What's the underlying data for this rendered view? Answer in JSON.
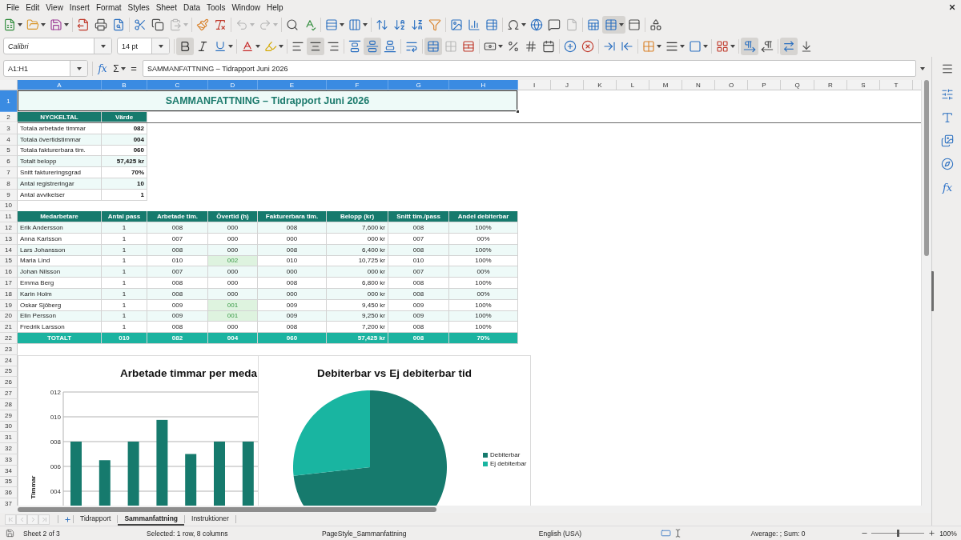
{
  "menu_bar": {
    "items": [
      "File",
      "Edit",
      "View",
      "Insert",
      "Format",
      "Styles",
      "Sheet",
      "Data",
      "Tools",
      "Window",
      "Help"
    ]
  },
  "standard_toolbar": {
    "groups": [
      [
        {
          "kind": "new",
          "on": false,
          "disabled": false
        },
        {
          "kind": "open",
          "on": false,
          "disabled": false
        },
        {
          "kind": "save",
          "on": false,
          "disabled": false
        }
      ],
      [
        {
          "kind": "export_pdf",
          "on": false,
          "disabled": false
        },
        {
          "kind": "print",
          "on": false,
          "disabled": false
        },
        {
          "kind": "print_preview",
          "on": false,
          "disabled": false
        }
      ],
      [
        {
          "kind": "cut",
          "on": false,
          "disabled": false
        },
        {
          "kind": "copy",
          "on": false,
          "disabled": false
        },
        {
          "kind": "paste",
          "on": false,
          "disabled": true
        }
      ],
      [
        {
          "kind": "clone_formatting",
          "on": false,
          "disabled": false
        },
        {
          "kind": "clear_formatting",
          "on": false,
          "disabled": false
        }
      ],
      [
        {
          "kind": "undo",
          "on": false,
          "disabled": true
        },
        {
          "kind": "redo",
          "on": false,
          "disabled": true
        }
      ],
      [
        {
          "kind": "find_replace",
          "on": false,
          "disabled": false
        },
        {
          "kind": "spelling",
          "on": false,
          "disabled": false
        }
      ],
      [
        {
          "kind": "rows",
          "on": false,
          "disabled": false
        },
        {
          "kind": "columns",
          "on": false,
          "disabled": false
        }
      ],
      [
        {
          "kind": "sort",
          "on": false,
          "disabled": false
        },
        {
          "kind": "sort_ascending",
          "on": false,
          "disabled": false
        },
        {
          "kind": "sort_descending",
          "on": false,
          "disabled": false
        },
        {
          "kind": "autofilter",
          "on": false,
          "disabled": false
        }
      ],
      [
        {
          "kind": "image",
          "on": false,
          "disabled": false
        },
        {
          "kind": "chart",
          "on": false,
          "disabled": false
        },
        {
          "kind": "pivot_table",
          "on": false,
          "disabled": false
        }
      ],
      [
        {
          "kind": "special_character",
          "on": false,
          "disabled": false
        },
        {
          "kind": "hyperlink",
          "on": false,
          "disabled": false
        },
        {
          "kind": "comment",
          "on": false,
          "disabled": false
        },
        {
          "kind": "headers_footers",
          "on": false,
          "disabled": true
        }
      ],
      [
        {
          "kind": "print_area",
          "on": false,
          "disabled": false
        },
        {
          "kind": "freeze",
          "on": true,
          "disabled": false
        },
        {
          "kind": "split_window",
          "on": false,
          "disabled": false
        }
      ],
      [
        {
          "kind": "shapes",
          "on": false,
          "disabled": false
        }
      ]
    ]
  },
  "formatting_toolbar": {
    "font_name": "Calibri",
    "font_size": "14 pt",
    "groups": [
      [
        {
          "kind": "bold",
          "on": true,
          "disabled": false
        },
        {
          "kind": "italic",
          "on": false,
          "disabled": false
        },
        {
          "kind": "underline",
          "on": false,
          "disabled": false
        }
      ],
      [
        {
          "kind": "font_color",
          "on": false,
          "disabled": false
        },
        {
          "kind": "highlight",
          "on": false,
          "disabled": false
        }
      ],
      [
        {
          "kind": "align_left",
          "on": false,
          "disabled": false
        },
        {
          "kind": "align_center",
          "on": true,
          "disabled": false
        },
        {
          "kind": "align_right",
          "on": false,
          "disabled": false
        }
      ],
      [
        {
          "kind": "align_top",
          "on": false,
          "disabled": false
        },
        {
          "kind": "align_middle",
          "on": true,
          "disabled": false
        },
        {
          "kind": "align_bottom",
          "on": false,
          "disabled": false
        }
      ],
      [
        {
          "kind": "wrap_text",
          "on": false,
          "disabled": false
        }
      ],
      [
        {
          "kind": "merge_center",
          "on": true,
          "disabled": false
        },
        {
          "kind": "merge_cells",
          "on": false,
          "disabled": true
        },
        {
          "kind": "unmerge_cells",
          "on": false,
          "disabled": false
        }
      ],
      [
        {
          "kind": "currency",
          "on": false,
          "disabled": false
        },
        {
          "kind": "percent",
          "on": false,
          "disabled": false
        },
        {
          "kind": "number",
          "on": false,
          "disabled": false
        },
        {
          "kind": "date",
          "on": false,
          "disabled": false
        }
      ],
      [
        {
          "kind": "add_decimal",
          "on": false,
          "disabled": false
        },
        {
          "kind": "delete_decimal",
          "on": false,
          "disabled": false
        }
      ],
      [
        {
          "kind": "indent_increase",
          "on": false,
          "disabled": false
        },
        {
          "kind": "indent_decrease",
          "on": false,
          "disabled": false
        }
      ],
      [
        {
          "kind": "borders",
          "on": false,
          "disabled": false
        },
        {
          "kind": "border_style",
          "on": false,
          "disabled": false
        },
        {
          "kind": "border_color",
          "on": false,
          "disabled": false
        }
      ],
      [
        {
          "kind": "conditional",
          "on": false,
          "disabled": false
        }
      ],
      [
        {
          "kind": "left_to_right",
          "on": true,
          "disabled": false
        },
        {
          "kind": "right_to_left",
          "on": false,
          "disabled": false
        }
      ],
      [
        {
          "kind": "text_direction",
          "on": true,
          "disabled": false
        },
        {
          "kind": "vertical_text",
          "on": false,
          "disabled": false
        }
      ]
    ]
  },
  "formula_bar": {
    "name_box": "A1:H1",
    "function_wizard": "fx",
    "sum": "Σ",
    "formula": "=",
    "content": "SAMMANFATTNING – Tidrapport Juni 2026"
  },
  "sidebar": {
    "decks": [
      {
        "kind": "menu"
      },
      {
        "kind": "properties"
      },
      {
        "kind": "styles"
      },
      {
        "kind": "gallery"
      },
      {
        "kind": "navigator"
      },
      {
        "kind": "functions",
        "glyph": "fx"
      }
    ]
  },
  "sheet": {
    "columns": [
      {
        "label": "A",
        "selected": true
      },
      {
        "label": "B",
        "selected": true
      },
      {
        "label": "C",
        "selected": true
      },
      {
        "label": "D",
        "selected": true
      },
      {
        "label": "E",
        "selected": true
      },
      {
        "label": "F",
        "selected": true
      },
      {
        "label": "G",
        "selected": true
      },
      {
        "label": "H",
        "selected": true
      },
      {
        "label": "I",
        "selected": false
      },
      {
        "label": "J",
        "selected": false
      },
      {
        "label": "K",
        "selected": false
      },
      {
        "label": "L",
        "selected": false
      },
      {
        "label": "M",
        "selected": false
      },
      {
        "label": "N",
        "selected": false
      },
      {
        "label": "O",
        "selected": false
      },
      {
        "label": "P",
        "selected": false
      },
      {
        "label": "Q",
        "selected": false
      },
      {
        "label": "R",
        "selected": false
      },
      {
        "label": "S",
        "selected": false
      },
      {
        "label": "T",
        "selected": false
      }
    ],
    "rows": [
      {
        "label": "1",
        "selected": true,
        "freeze_below": false
      },
      {
        "label": "2",
        "selected": false,
        "freeze_below": true
      },
      {
        "label": "3",
        "selected": false,
        "freeze_below": false
      },
      {
        "label": "4",
        "selected": false,
        "freeze_below": false
      },
      {
        "label": "5",
        "selected": false,
        "freeze_below": false
      },
      {
        "label": "6",
        "selected": false,
        "freeze_below": false
      },
      {
        "label": "7",
        "selected": false,
        "freeze_below": false
      },
      {
        "label": "8",
        "selected": false,
        "freeze_below": false
      },
      {
        "label": "9",
        "selected": false,
        "freeze_below": false
      },
      {
        "label": "10",
        "selected": false,
        "freeze_below": false
      },
      {
        "label": "11",
        "selected": false,
        "freeze_below": false
      },
      {
        "label": "12",
        "selected": false,
        "freeze_below": false
      },
      {
        "label": "13",
        "selected": false,
        "freeze_below": false
      },
      {
        "label": "14",
        "selected": false,
        "freeze_below": false
      },
      {
        "label": "15",
        "selected": false,
        "freeze_below": false
      },
      {
        "label": "16",
        "selected": false,
        "freeze_below": false
      },
      {
        "label": "17",
        "selected": false,
        "freeze_below": false
      },
      {
        "label": "18",
        "selected": false,
        "freeze_below": false
      },
      {
        "label": "19",
        "selected": false,
        "freeze_below": false
      },
      {
        "label": "20",
        "selected": false,
        "freeze_below": false
      },
      {
        "label": "21",
        "selected": false,
        "freeze_below": false
      },
      {
        "label": "22",
        "selected": false,
        "freeze_below": false
      },
      {
        "label": "23",
        "selected": false,
        "freeze_below": false
      },
      {
        "label": "24",
        "selected": false,
        "freeze_below": false
      },
      {
        "label": "25",
        "selected": false,
        "freeze_below": false
      },
      {
        "label": "26",
        "selected": false,
        "freeze_below": false
      },
      {
        "label": "27",
        "selected": false,
        "freeze_below": false
      },
      {
        "label": "28",
        "selected": false,
        "freeze_below": false
      },
      {
        "label": "29",
        "selected": false,
        "freeze_below": false
      },
      {
        "label": "30",
        "selected": false,
        "freeze_below": false
      },
      {
        "label": "31",
        "selected": false,
        "freeze_below": false
      },
      {
        "label": "32",
        "selected": false,
        "freeze_below": false
      },
      {
        "label": "33",
        "selected": false,
        "freeze_below": false
      },
      {
        "label": "34",
        "selected": false,
        "freeze_below": false
      },
      {
        "label": "35",
        "selected": false,
        "freeze_below": false
      },
      {
        "label": "36",
        "selected": false,
        "freeze_below": false
      },
      {
        "label": "37",
        "selected": false,
        "freeze_below": false
      }
    ],
    "title": {
      "text": "SAMMANFATTNING – Tidrapport Juni 2026",
      "selected": true
    },
    "key_figures": {
      "header": [
        "NYCKELTAL",
        "Värde"
      ],
      "rows": [
        {
          "label": "Totala arbetade timmar",
          "value": "082",
          "shaded": false
        },
        {
          "label": "Totala övertidstimmar",
          "value": "004",
          "shaded": true
        },
        {
          "label": "Totala fakturerbara tim.",
          "value": "060",
          "shaded": false
        },
        {
          "label": "Totalt belopp",
          "value": "57,425 kr",
          "shaded": true
        },
        {
          "label": "Snitt faktureringsgrad",
          "value": "70%",
          "shaded": false
        },
        {
          "label": "Antal registreringar",
          "value": "10",
          "shaded": true
        },
        {
          "label": "Antal avvikelser",
          "value": "1",
          "shaded": false
        }
      ]
    },
    "employees": {
      "header": [
        "Medarbetare",
        "Antal pass",
        "Arbetade tim.",
        "Övertid (h)",
        "Fakturerbara tim.",
        "Belopp (kr)",
        "Snitt tim./pass",
        "Andel debiterbar"
      ],
      "rows": [
        {
          "cells": [
            "Erik Andersson",
            "1",
            "008",
            "000",
            "008",
            "7,600 kr",
            "008",
            "100%"
          ],
          "shaded": true,
          "overtime_flagged": false
        },
        {
          "cells": [
            "Anna Karlsson",
            "1",
            "007",
            "000",
            "000",
            "000 kr",
            "007",
            "00%"
          ],
          "shaded": false,
          "overtime_flagged": false
        },
        {
          "cells": [
            "Lars Johansson",
            "1",
            "008",
            "000",
            "008",
            "6,400 kr",
            "008",
            "100%"
          ],
          "shaded": true,
          "overtime_flagged": false
        },
        {
          "cells": [
            "Maria Lind",
            "1",
            "010",
            "002",
            "010",
            "10,725 kr",
            "010",
            "100%"
          ],
          "shaded": false,
          "overtime_flagged": true
        },
        {
          "cells": [
            "Johan Nilsson",
            "1",
            "007",
            "000",
            "000",
            "000 kr",
            "007",
            "00%"
          ],
          "shaded": true,
          "overtime_flagged": false
        },
        {
          "cells": [
            "Emma Berg",
            "1",
            "008",
            "000",
            "008",
            "6,800 kr",
            "008",
            "100%"
          ],
          "shaded": false,
          "overtime_flagged": false
        },
        {
          "cells": [
            "Karin Holm",
            "1",
            "008",
            "000",
            "000",
            "000 kr",
            "008",
            "00%"
          ],
          "shaded": true,
          "overtime_flagged": false
        },
        {
          "cells": [
            "Oskar Sjöberg",
            "1",
            "009",
            "001",
            "009",
            "9,450 kr",
            "009",
            "100%"
          ],
          "shaded": false,
          "overtime_flagged": true
        },
        {
          "cells": [
            "Elin Persson",
            "1",
            "009",
            "001",
            "009",
            "9,250 kr",
            "009",
            "100%"
          ],
          "shaded": true,
          "overtime_flagged": true
        },
        {
          "cells": [
            "Fredrik Larsson",
            "1",
            "008",
            "000",
            "008",
            "7,200 kr",
            "008",
            "100%"
          ],
          "shaded": false,
          "overtime_flagged": false
        }
      ],
      "total": [
        "TOTALT",
        "010",
        "082",
        "004",
        "060",
        "57,425 kr",
        "008",
        "70%"
      ]
    },
    "charts": [
      {
        "chart_data": {
          "type": "bar",
          "title": "Arbetade timmar per meda",
          "ylabel": "Timmar",
          "series": [
            {
              "color": "#167a6d",
              "values": [
                8,
                6.5,
                8,
                9.75,
                7,
                8,
                8
              ]
            }
          ],
          "ylim": [
            0,
            12
          ],
          "yticks": [
            {
              "value": 4,
              "label": "004"
            },
            {
              "value": 6,
              "label": "006"
            },
            {
              "value": 8,
              "label": "008"
            },
            {
              "value": 10,
              "label": "010"
            },
            {
              "value": 12,
              "label": "012"
            }
          ],
          "grid": true
        }
      },
      {
        "chart_data": {
          "type": "pie",
          "title": "Debiterbar vs Ej debiterbar tid",
          "categories": [
            "Debiterbar",
            "Ej debiterbar"
          ],
          "values": [
            73.2,
            26.8
          ],
          "legend": "right"
        },
        "slices": [
          {
            "color": "#167a6d"
          },
          {
            "color": "#19b5a1"
          }
        ]
      }
    ]
  },
  "sheet_tabs": {
    "scroll_buttons": [
      {
        "kind": "first",
        "disabled": true
      },
      {
        "kind": "previous",
        "disabled": true
      },
      {
        "kind": "next",
        "disabled": true
      },
      {
        "kind": "last",
        "disabled": true
      }
    ],
    "tabs": [
      {
        "label": "Tidrapport",
        "selected": false
      },
      {
        "label": "Sammanfattning",
        "selected": true
      },
      {
        "label": "Instruktioner",
        "selected": false
      }
    ]
  },
  "status_bar": {
    "sheet": "Sheet 2 of 3",
    "selection": "Selected: 1 row, 8 columns",
    "page_style": "PageStyle_Sammanfattning",
    "language": "English (USA)",
    "summary": "Average: ; Sum: 0",
    "zoom": {
      "level": 0.5,
      "reading": "100%"
    }
  }
}
